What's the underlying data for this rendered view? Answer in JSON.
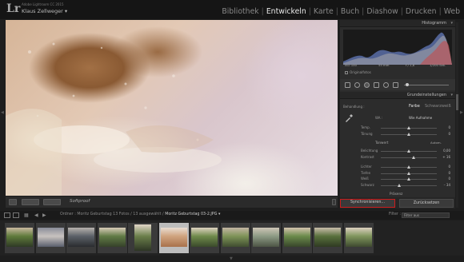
{
  "app": {
    "logo": "Lr",
    "product": "Adobe Lightroom CC 2015",
    "user": "Klaus Zellweger ▾"
  },
  "modules": [
    {
      "label": "Bibliothek",
      "active": false
    },
    {
      "label": "Entwickeln",
      "active": true
    },
    {
      "label": "Karte",
      "active": false
    },
    {
      "label": "Buch",
      "active": false
    },
    {
      "label": "Diashow",
      "active": false
    },
    {
      "label": "Drucken",
      "active": false
    },
    {
      "label": "Web",
      "active": false
    }
  ],
  "photo_toolbar": {
    "softproof": "Softproof"
  },
  "histogram": {
    "title": "Histogramm",
    "info": [
      "ISO 100",
      "55 mm",
      "f / 1,8",
      "1/200 Sek."
    ],
    "original_label": "Originalfotos"
  },
  "basic": {
    "title": "Grundeinstellungen",
    "treatment_label": "Behandlung :",
    "treatment_color": "Farbe",
    "treatment_bw": "Schwarzweiß",
    "wb_label": "WA :",
    "wb_value": "Wie Aufnahme",
    "sliders_wb": [
      {
        "label": "Temp.",
        "value": "0",
        "pos": 0.5
      },
      {
        "label": "Tönung",
        "value": "0",
        "pos": 0.5
      }
    ],
    "tone_label": "Tonwert",
    "auto_label": "Autom.",
    "sliders_tone": [
      {
        "label": "Belichtung",
        "value": "0,00",
        "pos": 0.5
      },
      {
        "label": "Kontrast",
        "value": "+ 16",
        "pos": 0.58
      }
    ],
    "sliders_presence": [
      {
        "label": "Lichter",
        "value": "0",
        "pos": 0.5
      },
      {
        "label": "Tiefen",
        "value": "0",
        "pos": 0.5
      },
      {
        "label": "Weiß",
        "value": "0",
        "pos": 0.5
      },
      {
        "label": "Schwarz",
        "value": "– 34",
        "pos": 0.33
      }
    ],
    "presence_label": "Präsenz"
  },
  "bottom_buttons": {
    "sync": "Synchronisieren...",
    "reset": "Zurücksetzen"
  },
  "filmstrip_header": {
    "folder_prefix": "Ordner : Moritz Geburtstag",
    "count_text": "13 Fotos / 13 ausgewählt /",
    "filename": "Moritz Geburtstag 03-2.JPG ▾",
    "filter_label": "Filter :",
    "filter_value": "Filter aus"
  },
  "colors": {
    "accent_red": "#cc1d1d",
    "active_module": "#e8e8e8",
    "panel_bg": "#2c2c2c"
  },
  "filmstrip": [
    {
      "orientation": "landscape",
      "selected": false,
      "colors": [
        "#5e7a3b",
        "#c9b89e",
        "#2f3a25"
      ]
    },
    {
      "orientation": "landscape",
      "selected": false,
      "colors": [
        "#c8c2bf",
        "#8a8d99",
        "#5a5f6d"
      ]
    },
    {
      "orientation": "landscape",
      "selected": false,
      "colors": [
        "#5b6067",
        "#b7b2ad",
        "#2a2c30"
      ]
    },
    {
      "orientation": "landscape",
      "selected": false,
      "colors": [
        "#607a45",
        "#d8cbb7",
        "#36422a"
      ]
    },
    {
      "orientation": "portrait",
      "selected": false,
      "colors": [
        "#6a7e4a",
        "#e1d6c7",
        "#2d3524"
      ]
    },
    {
      "orientation": "landscape",
      "selected": true,
      "colors": [
        "#cfa37e",
        "#e9ddd2",
        "#a9714b"
      ]
    },
    {
      "orientation": "landscape",
      "selected": false,
      "colors": [
        "#6f8a4b",
        "#ded2c0",
        "#3a4a2b"
      ]
    },
    {
      "orientation": "landscape",
      "selected": false,
      "colors": [
        "#7d9357",
        "#c3b5a2",
        "#404d30"
      ]
    },
    {
      "orientation": "landscape",
      "selected": false,
      "colors": [
        "#8c9a84",
        "#cec5b6",
        "#4d5545"
      ]
    },
    {
      "orientation": "landscape",
      "selected": false,
      "colors": [
        "#6a8a4a",
        "#d4c4ae",
        "#38462b"
      ]
    },
    {
      "orientation": "landscape",
      "selected": false,
      "colors": [
        "#58703c",
        "#c8bca9",
        "#2f3a22"
      ]
    },
    {
      "orientation": "landscape",
      "selected": false,
      "colors": [
        "#7f955c",
        "#dcd0bf",
        "#3f4a30"
      ]
    }
  ]
}
